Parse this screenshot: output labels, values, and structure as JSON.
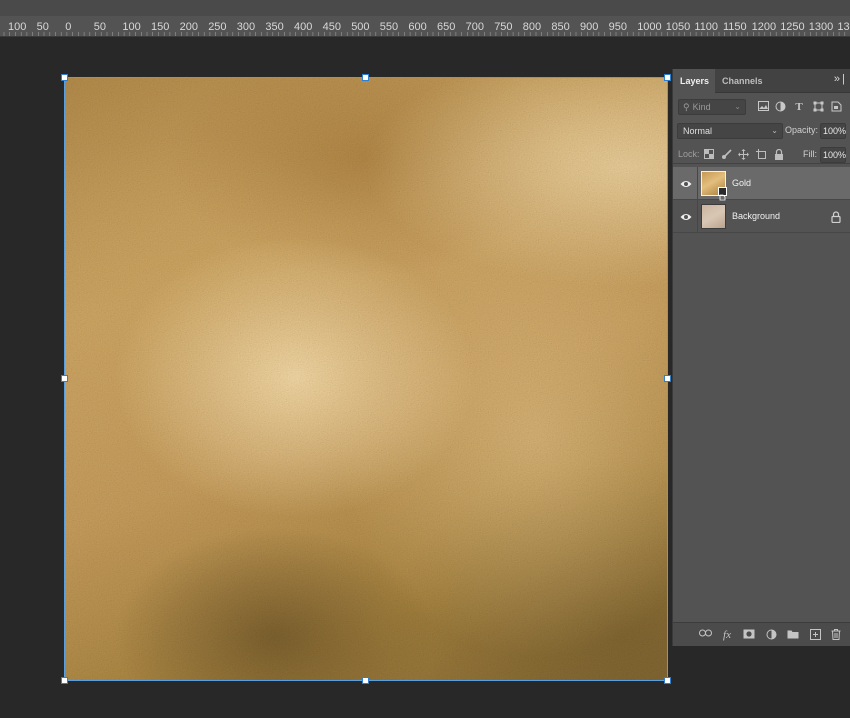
{
  "ruler": {
    "labels": [
      "100",
      "50",
      "0",
      "50",
      "100",
      "150",
      "200",
      "250",
      "300",
      "350",
      "400",
      "450",
      "500",
      "550",
      "600",
      "650",
      "700",
      "750",
      "800",
      "850",
      "900",
      "950",
      "1000",
      "1050",
      "1100",
      "1150",
      "1200",
      "1250",
      "1300",
      "135"
    ]
  },
  "document": {
    "layer_content": "gold foil texture",
    "selection_color": "#5aa0e0"
  },
  "layers_panel": {
    "tabs": [
      {
        "label": "Layers",
        "active": true
      },
      {
        "label": "Channels",
        "active": false
      }
    ],
    "menu_icon": "panel-menu-icon",
    "filter": {
      "kind_placeholder": "Kind",
      "icons": [
        "image-filter-icon",
        "adjustment-filter-icon",
        "type-filter-icon",
        "shape-filter-icon",
        "smart-object-filter-icon"
      ]
    },
    "blend_mode": "Normal",
    "opacity_label": "Opacity:",
    "opacity_value": "100%",
    "lock_label": "Lock:",
    "lock_icons": [
      "lock-transparent-pixels-icon",
      "lock-image-pixels-icon",
      "lock-position-icon",
      "lock-artboard-icon",
      "lock-all-icon"
    ],
    "fill_label": "Fill:",
    "fill_value": "100%",
    "layers": [
      {
        "name": "Gold",
        "visible": true,
        "selected": true,
        "smart_object": true,
        "locked": false
      },
      {
        "name": "Background",
        "visible": true,
        "selected": false,
        "smart_object": false,
        "locked": true
      }
    ],
    "footer_icons": [
      "link-layers-icon",
      "fx-icon",
      "add-mask-icon",
      "adjustment-layer-icon",
      "new-group-icon",
      "new-layer-icon",
      "delete-layer-icon"
    ]
  }
}
